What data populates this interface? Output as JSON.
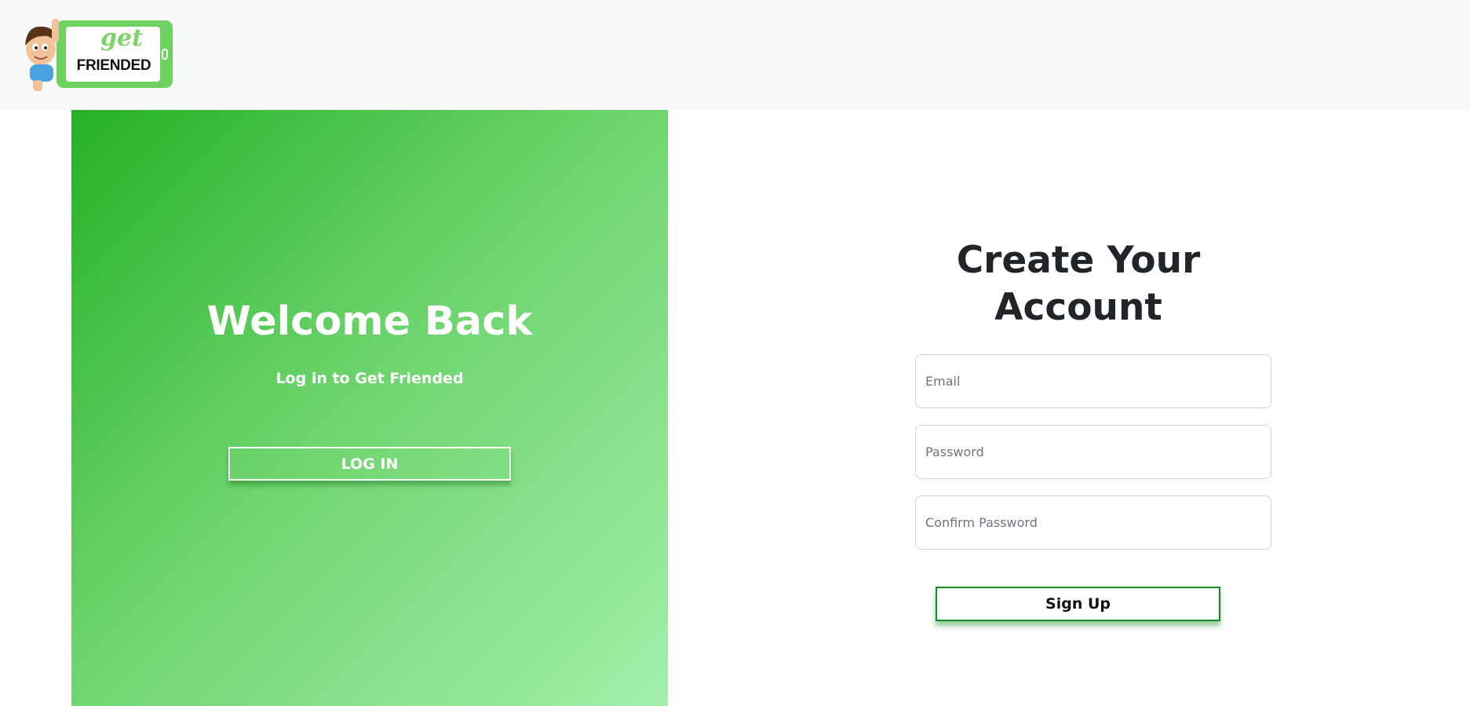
{
  "logo": {
    "top_text": "get",
    "bottom_text": "FRIENDED",
    "icon": "get-friended-logo-icon",
    "color_phone": "#6fd160"
  },
  "welcome_panel": {
    "title": "Welcome Back",
    "subtitle": "Log in to Get Friended",
    "login_button": "LOG IN",
    "gradient_start": "#25b125",
    "gradient_end": "#a3efaa"
  },
  "signup": {
    "title": "Create Your Account",
    "email_placeholder": "Email",
    "password_placeholder": "Password",
    "confirm_password_placeholder": "Confirm Password",
    "signup_button": "Sign Up",
    "button_accent": "#138a25"
  }
}
